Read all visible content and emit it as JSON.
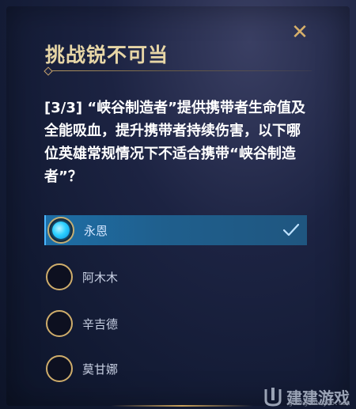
{
  "dialog": {
    "title": "挑战锐不可当",
    "close_icon": "close-icon",
    "question": "[3/3] “峡谷制造者”提供携带者生命值及全能吸血，提升携带者持续伤害，以下哪位英雄常规情况下不适合携带“峡谷制造者”？",
    "options": [
      {
        "label": "永恩",
        "selected": true
      },
      {
        "label": "阿木木",
        "selected": false
      },
      {
        "label": "辛吉德",
        "selected": false
      },
      {
        "label": "莫甘娜",
        "selected": false
      }
    ]
  },
  "watermark": {
    "text": "建建游戏",
    "url": "guangzhoujob.com"
  },
  "colors": {
    "title": "#e7d6a6",
    "accent_gold": "#cfad6b",
    "selected_bg": "#1e6ea6",
    "radio_active": "#2cd0ff"
  }
}
